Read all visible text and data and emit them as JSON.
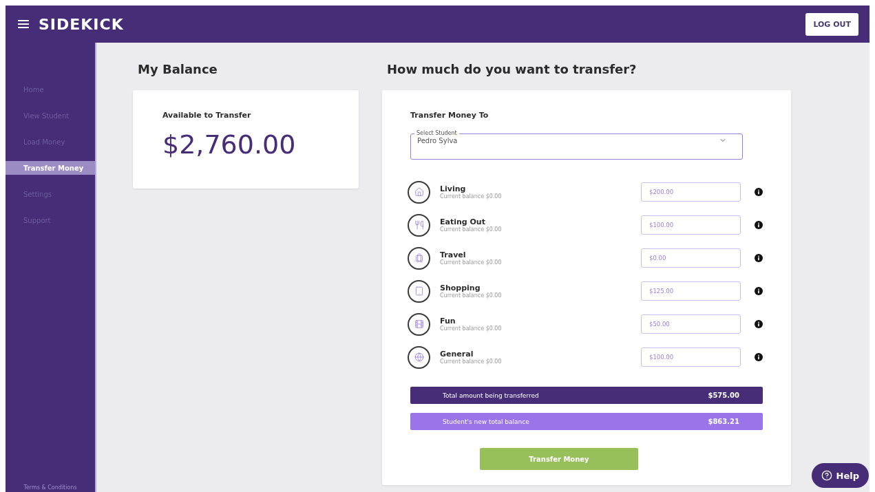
{
  "header": {
    "logo": "SIDEKICK",
    "logout": "LOG OUT"
  },
  "sidebar": {
    "items": [
      {
        "label": "Home",
        "selected": false
      },
      {
        "label": "View Student",
        "selected": false
      },
      {
        "label": "Load Money",
        "selected": false
      },
      {
        "label": "Transfer Money",
        "selected": true
      },
      {
        "label": "Settings",
        "selected": false
      },
      {
        "label": "Support",
        "selected": false
      }
    ],
    "footer": "Terms & Conditions"
  },
  "balance": {
    "title": "My Balance",
    "label": "Available to Transfer",
    "amount": "$2,760.00"
  },
  "transfer": {
    "title": "How much do you want to transfer?",
    "section": "Transfer Money To",
    "select": {
      "label": "Select Student",
      "value": "Pedro Sylva"
    },
    "categories": [
      {
        "kind": "home",
        "name": "Living",
        "balance": "Current balance $0.00",
        "amount": "$200.00"
      },
      {
        "kind": "food",
        "name": "Eating Out",
        "balance": "Current balance $0.00",
        "amount": "$100.00"
      },
      {
        "kind": "luggage",
        "name": "Travel",
        "balance": "Current balance $0.00",
        "amount": "$0.00"
      },
      {
        "kind": "tablet",
        "name": "Shopping",
        "balance": "Current balance $0.00",
        "amount": "$125.00"
      },
      {
        "kind": "film",
        "name": "Fun",
        "balance": "Current balance $0.00",
        "amount": "$50.00"
      },
      {
        "kind": "globe",
        "name": "General",
        "balance": "Current balance $0.00",
        "amount": "$100.00"
      }
    ],
    "totals": [
      {
        "kind": "dark",
        "label": "Total amount being transferred",
        "value": "$575.00"
      },
      {
        "kind": "light",
        "label": "Student's new total balance",
        "value": "$863.21"
      }
    ],
    "button": "Transfer Money"
  },
  "help": "Help"
}
